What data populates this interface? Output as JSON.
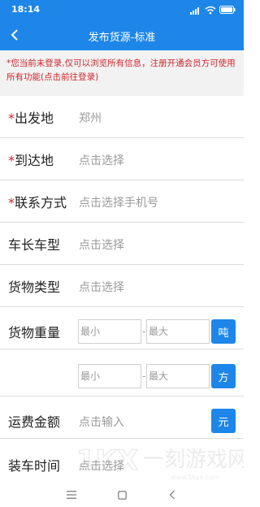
{
  "status_bar": {
    "time": "18:14"
  },
  "header": {
    "title": "发布货源-标准"
  },
  "notice": {
    "text": "*您当前未登录,仅可以浏览所有信息，注册开通会员方可使用所有功能(点击前往登录)"
  },
  "form": {
    "departure": {
      "required_mark": "*",
      "label": "出发地",
      "value": "郑州"
    },
    "destination": {
      "required_mark": "*",
      "label": "到达地",
      "placeholder": "点击选择"
    },
    "contact": {
      "required_mark": "*",
      "label": "联系方式",
      "placeholder": "点击选择手机号"
    },
    "vehicle": {
      "label": "车长车型",
      "placeholder": "点击选择"
    },
    "cargo_type": {
      "label": "货物类型",
      "placeholder": "点击选择"
    },
    "weight": {
      "label": "货物重量",
      "min_placeholder": "最小",
      "separator": "-",
      "max_placeholder": "最大",
      "unit": "吨"
    },
    "volume": {
      "min_placeholder": "最小",
      "separator": "-",
      "max_placeholder": "最大",
      "unit": "方"
    },
    "freight": {
      "label": "运费金额",
      "placeholder": "点击输入",
      "unit": "元"
    },
    "loading_time": {
      "label": "装车时间",
      "placeholder": "点击选择"
    }
  },
  "watermark": {
    "text": "1kyx 一刻游戏网 www.1kyx.com"
  },
  "colors": {
    "primary": "#1e86e8",
    "required": "#d0262d",
    "placeholder": "#9a9a9a",
    "divider": "#dcdcdc"
  }
}
